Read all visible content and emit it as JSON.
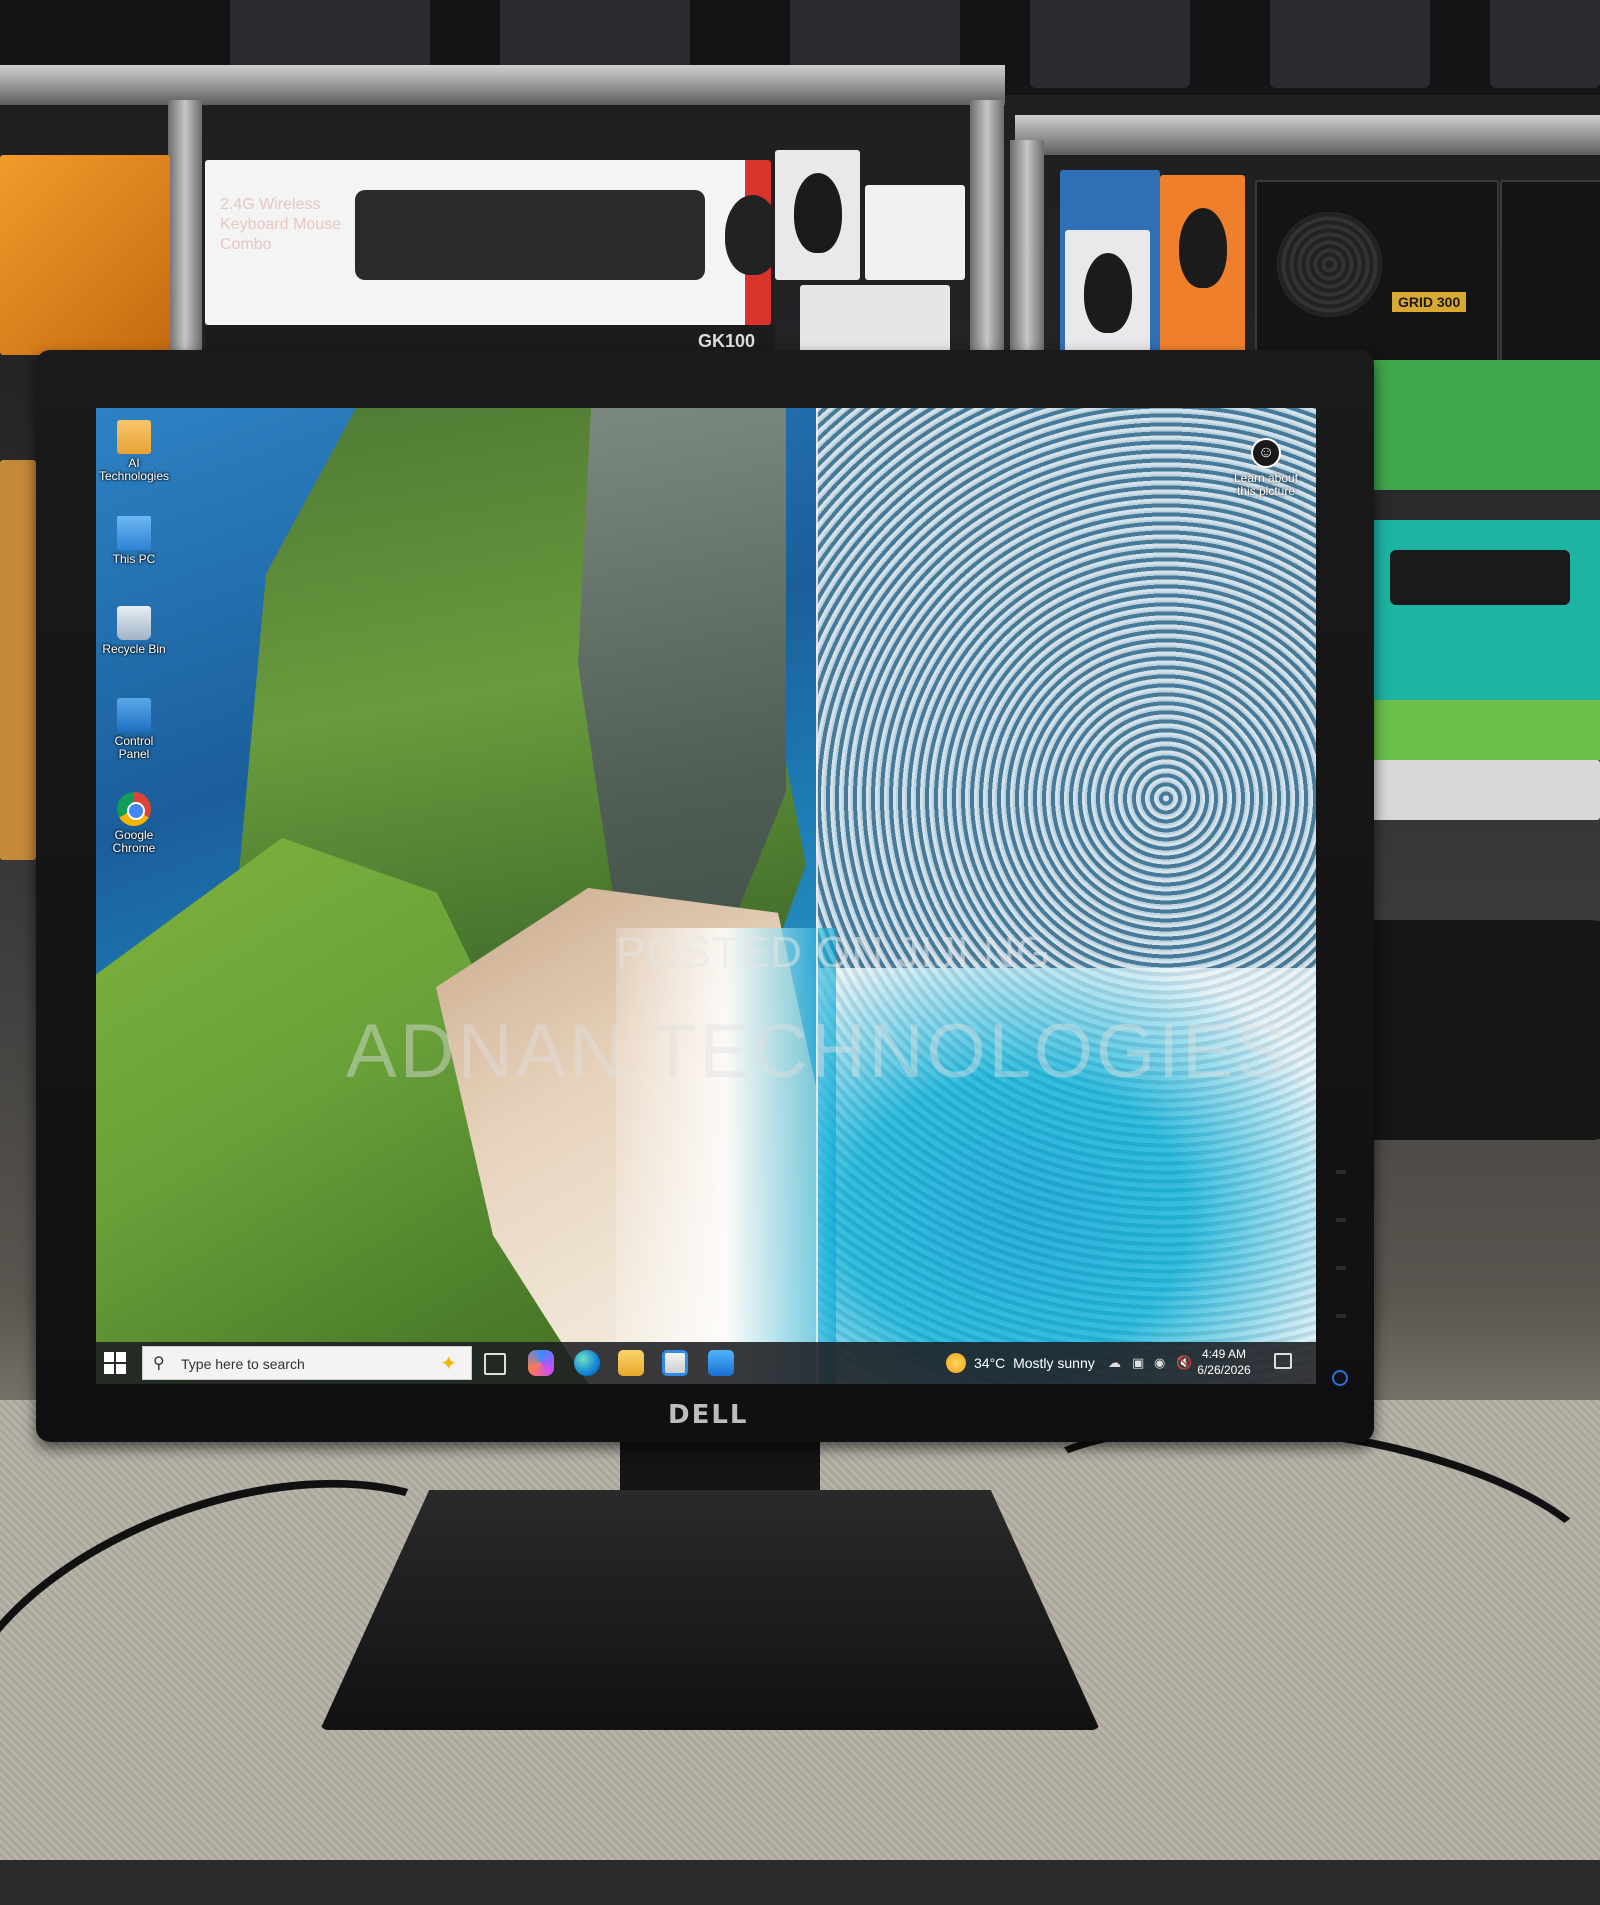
{
  "store": {
    "keyboard_box_text": "2.4G Wireless Keyboard Mouse Combo",
    "keyboard_box_model": "GK100",
    "psu_label": "GRID 300"
  },
  "monitor": {
    "brand": "DELL"
  },
  "desktop": {
    "icons": [
      {
        "label": "AI Technologies",
        "icon": "folder-user-icon"
      },
      {
        "label": "This PC",
        "icon": "computer-icon"
      },
      {
        "label": "Recycle Bin",
        "icon": "recycle-bin-icon"
      },
      {
        "label": "Control Panel",
        "icon": "control-panel-icon"
      },
      {
        "label": "Google Chrome",
        "icon": "chrome-icon"
      }
    ],
    "learn_about": "Learn about this picture",
    "watermark_line1": "POSTED ON JIJI.NG",
    "watermark_line2": "ADNAN TECHNOLOGIES"
  },
  "taskbar": {
    "search_placeholder": "Type here to search",
    "weather_temp": "34°C",
    "weather_desc": "Mostly sunny",
    "time": "4:49 AM",
    "date": "6/26/2026",
    "apps": [
      "task-view-icon",
      "copilot-icon",
      "edge-icon",
      "file-explorer-icon",
      "store-icon",
      "mail-icon"
    ]
  }
}
